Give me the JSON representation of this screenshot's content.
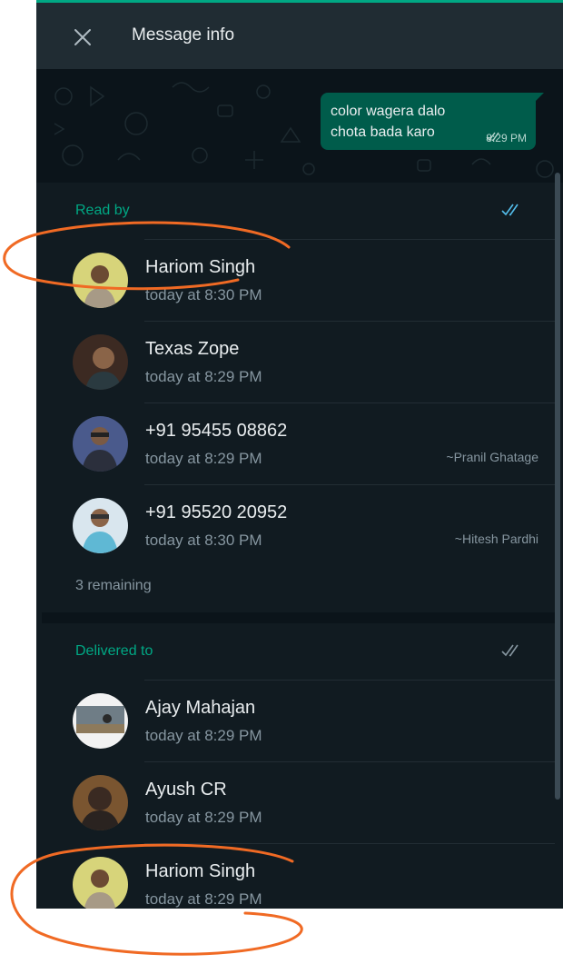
{
  "header": {
    "title": "Message info",
    "close_icon": "close-icon"
  },
  "message": {
    "text": "color wagera dalo\nchota bada karo",
    "time": "8:29 PM",
    "status_icon": "double-check-icon"
  },
  "read_by": {
    "title": "Read by",
    "icon": "double-check-blue-icon",
    "icon_color": "#53bdeb",
    "entries": [
      {
        "name": "Hariom Singh",
        "time": "today at 8:30 PM",
        "pushname": ""
      },
      {
        "name": "Texas Zope",
        "time": "today at 8:29 PM",
        "pushname": ""
      },
      {
        "name": "+91 95455 08862",
        "time": "today at 8:29 PM",
        "pushname": "~Pranil Ghatage"
      },
      {
        "name": "+91 95520 20952",
        "time": "today at 8:30 PM",
        "pushname": "~Hitesh Pardhi"
      }
    ],
    "remaining": "3 remaining"
  },
  "delivered_to": {
    "title": "Delivered to",
    "icon": "double-check-grey-icon",
    "icon_color": "#8696a0",
    "entries": [
      {
        "name": "Ajay Mahajan",
        "time": "today at 8:29 PM"
      },
      {
        "name": "Ayush CR",
        "time": "today at 8:29 PM"
      },
      {
        "name": "Hariom Singh",
        "time": "today at 8:29 PM"
      }
    ]
  },
  "colors": {
    "accent": "#00a884",
    "annotation": "#f06a24",
    "background": "#111b21",
    "bubble": "#005c4b"
  }
}
